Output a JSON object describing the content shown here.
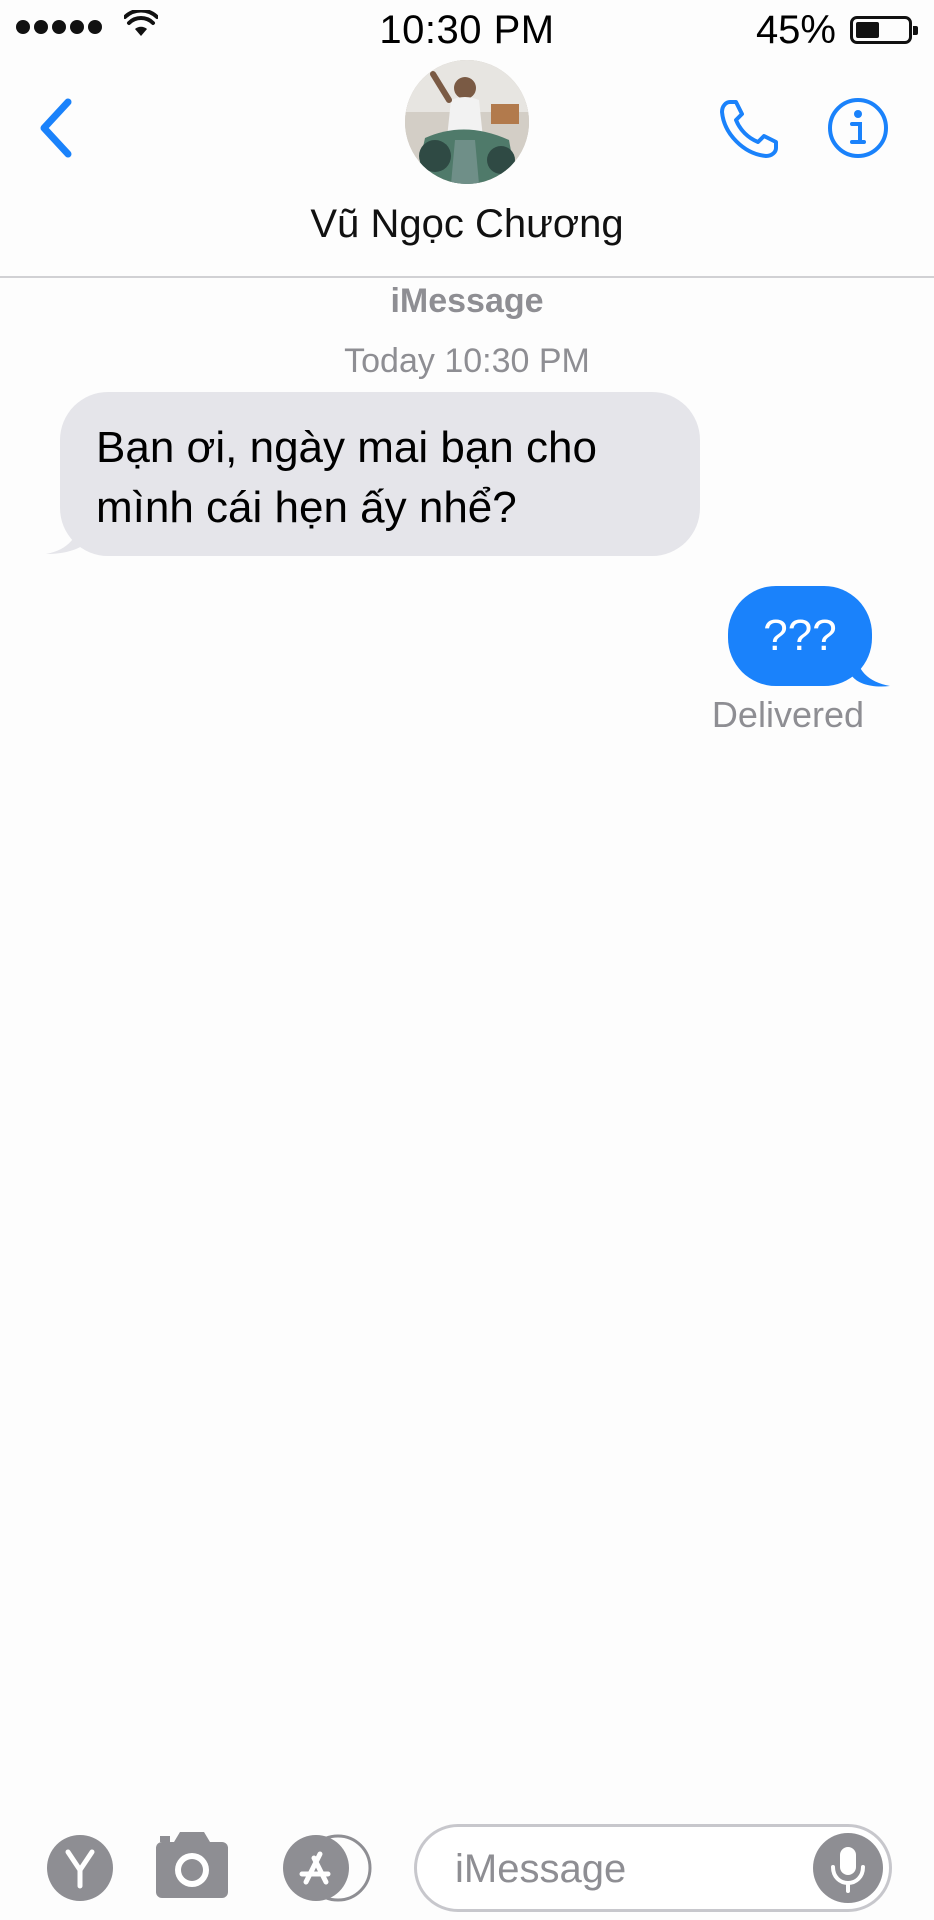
{
  "status_bar": {
    "time": "10:30 PM",
    "battery_percent": "45%",
    "battery_level": 0.45,
    "signal_bars": 5,
    "icons": [
      "signal-dots",
      "wifi-icon",
      "battery-icon"
    ]
  },
  "header": {
    "contact_name": "Vũ Ngọc Chương",
    "icons": [
      "chevron-left-icon",
      "phone-icon",
      "info-icon"
    ],
    "accent_color": "#1a82fb"
  },
  "conversation": {
    "service_label": "iMessage",
    "timestamp": "Today 10:30 PM",
    "messages": [
      {
        "direction": "incoming",
        "line1": "Bạn ơi, ngày mai bạn cho",
        "line2": "mình cái hẹn ấy nhể?",
        "bubble_color": "#e5e5ea"
      },
      {
        "direction": "outgoing",
        "text": "???",
        "bubble_color": "#1a82fb"
      }
    ],
    "status": "Delivered"
  },
  "input_bar": {
    "placeholder": "iMessage",
    "icons": [
      "app-y-icon",
      "camera-icon",
      "app-store-icon",
      "microphone-icon"
    ]
  }
}
